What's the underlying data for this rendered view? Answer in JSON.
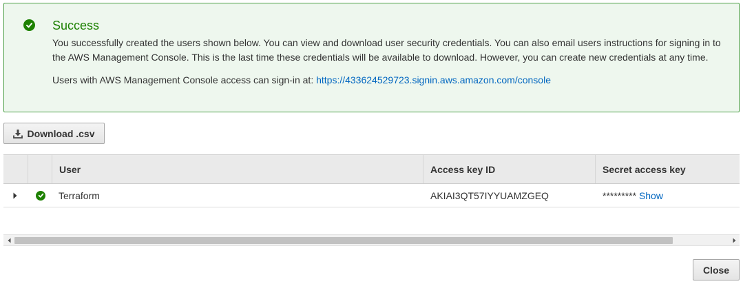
{
  "alert": {
    "title": "Success",
    "message": "You successfully created the users shown below. You can view and download user security credentials. You can also email users instructions for signing in to the AWS Management Console. This is the last time these credentials will be available to download. However, you can create new credentials at any time.",
    "signin_prefix": "Users with AWS Management Console access can sign-in at: ",
    "signin_url": "https://433624529723.signin.aws.amazon.com/console",
    "icon": "check-circle-icon"
  },
  "toolbar": {
    "download_label": "Download .csv",
    "download_icon": "download-icon"
  },
  "table": {
    "columns": [
      "User",
      "Access key ID",
      "Secret access key"
    ],
    "rows": [
      {
        "user": "Terraform",
        "access_key_id": "AKIAI3QT57IYYUAMZGEQ",
        "secret_masked": "*********",
        "secret_show_label": "Show"
      }
    ]
  },
  "footer": {
    "close_label": "Close"
  },
  "colors": {
    "success_green": "#1d8102",
    "alert_bg": "#eef7ee",
    "alert_border": "#4c9f46",
    "link_blue": "#0066c0"
  }
}
